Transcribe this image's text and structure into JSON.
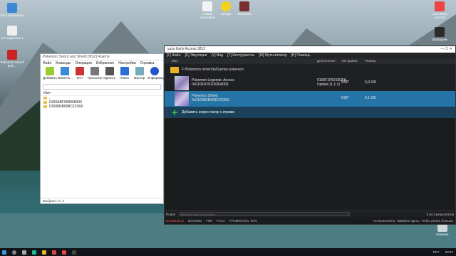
{
  "desktop": {
    "icons": [
      {
        "label": "Этот компьютер"
      },
      {
        "label": "Не выделено 1"
      },
      {
        "label": "Pokemon Sword and ..."
      },
      {
        "label": "Новый текстовый"
      },
      {
        "label": "звезды"
      },
      {
        "label": "obrabotka"
      },
      {
        "label": "yuzu Early Access"
      },
      {
        "label": "Проводник"
      },
      {
        "label": "Корзина"
      }
    ]
  },
  "zip": {
    "title": "Pokemon Sword and Shield [NSZ] Ruarhe",
    "menu": [
      "Файл",
      "Команды",
      "Операции",
      "Избранное",
      "Настройки",
      "Справка"
    ],
    "tools": [
      "Добавить",
      "Извлечь...",
      "Тест",
      "Просмотр",
      "Удалить",
      "Поиск",
      "Мастер",
      "Информация"
    ],
    "header": "Имя",
    "rows": [
      ".",
      "0100ABF008968000",
      "01008DB008C2C000"
    ],
    "status": "Выбрано: 0 / 2"
  },
  "yuzu": {
    "title": "yuzu Early Access 3812",
    "menu": [
      "[F] Файл",
      "[E] Эмуляция",
      "[V] Вид",
      "[T] Инструменты",
      "[M] Мультиплеер",
      "[H] Помощь"
    ],
    "cols": {
      "name": "Имя",
      "addons": "Дополнения",
      "type": "Тип файла",
      "size": "Размер"
    },
    "dir": "F:/Pokemon nintendo/Games pokemon",
    "games": [
      {
        "name": "Pokemon Legends: Arceus",
        "id": "0x01001F5010DFA000",
        "addons": "0100F1F5010DFA... Update (1.1.1)",
        "type": "NSP",
        "size": "6,0 GB"
      },
      {
        "name": "Pokemon Shield",
        "id": "0x01008DB008C2C000",
        "addons": "",
        "type": "NSP",
        "size": "9,1 GB"
      }
    ],
    "add_label": "Добавить новую папку с играми",
    "search_label": "Поиск:",
    "search_placeholder": "Введите текст для поиска",
    "result": "2 из 2 результатов",
    "status": [
      "HANDHELD",
      "DOCKED",
      "FSR",
      "FXAA",
      "ГРОМКОСТЬ: 50%"
    ],
    "status_right": "Не выполнено. Нажмите здесь, чтобы узнать больше."
  },
  "taskbar": {
    "time": "23:27",
    "date": "...",
    "lang": "РУС"
  }
}
